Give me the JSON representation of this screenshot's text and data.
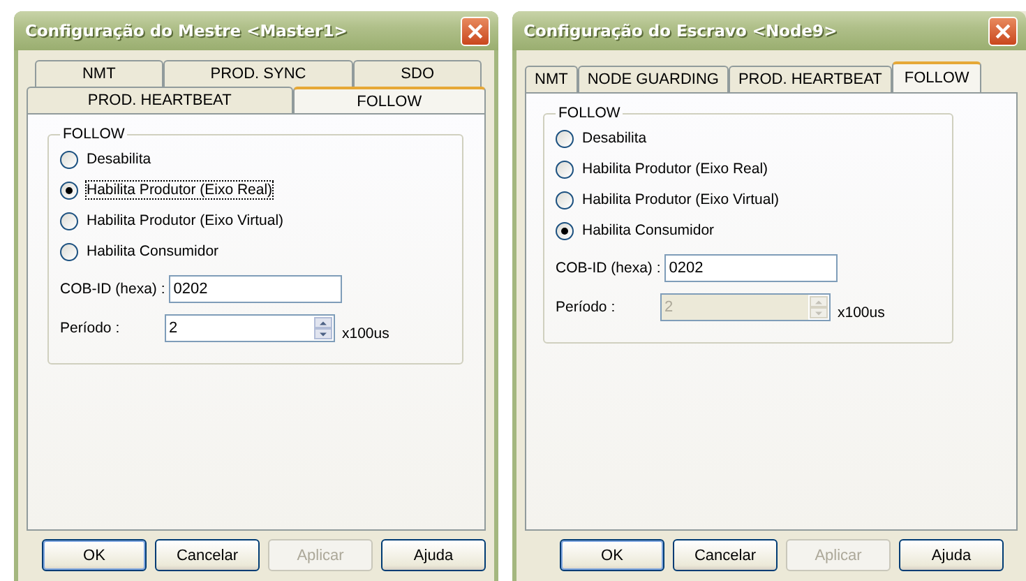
{
  "dialogs": [
    {
      "title": "Configuração do Mestre <Master1>",
      "tab_rows": [
        [
          {
            "label": "NMT",
            "selected": false
          },
          {
            "label": "PROD. SYNC",
            "selected": false
          },
          {
            "label": "SDO",
            "selected": false
          }
        ],
        [
          {
            "label": "PROD. HEARTBEAT",
            "selected": false
          },
          {
            "label": "FOLLOW",
            "selected": true
          }
        ]
      ],
      "group": {
        "title": "FOLLOW",
        "options": [
          {
            "label": "Desabilita",
            "selected": false,
            "focused": false
          },
          {
            "label": "Habilita Produtor (Eixo Real)",
            "selected": true,
            "focused": true
          },
          {
            "label": "Habilita Produtor (Eixo Virtual)",
            "selected": false,
            "focused": false
          },
          {
            "label": "Habilita Consumidor",
            "selected": false,
            "focused": false
          }
        ],
        "cob_id": {
          "label": "COB-ID (hexa) :",
          "value": "0202"
        },
        "periodo": {
          "label": "Período :",
          "value": "2",
          "disabled": false,
          "unit": "x100us"
        }
      },
      "buttons": [
        {
          "label": "OK",
          "disabled": false,
          "default": true
        },
        {
          "label": "Cancelar",
          "disabled": false,
          "default": false
        },
        {
          "label": "Aplicar",
          "disabled": true,
          "default": false
        },
        {
          "label": "Ajuda",
          "disabled": false,
          "default": false
        }
      ]
    },
    {
      "title": "Configuração do Escravo <Node9>",
      "tab_rows": [
        [
          {
            "label": "NMT",
            "selected": false
          },
          {
            "label": "NODE GUARDING",
            "selected": false
          },
          {
            "label": "PROD. HEARTBEAT",
            "selected": false
          },
          {
            "label": "FOLLOW",
            "selected": true
          }
        ]
      ],
      "group": {
        "title": "FOLLOW",
        "options": [
          {
            "label": "Desabilita",
            "selected": false,
            "focused": false
          },
          {
            "label": "Habilita Produtor (Eixo Real)",
            "selected": false,
            "focused": false
          },
          {
            "label": "Habilita Produtor (Eixo Virtual)",
            "selected": false,
            "focused": false
          },
          {
            "label": "Habilita Consumidor",
            "selected": true,
            "focused": false
          }
        ],
        "cob_id": {
          "label": "COB-ID (hexa) :",
          "value": "0202"
        },
        "periodo": {
          "label": "Período :",
          "value": "2",
          "disabled": true,
          "unit": "x100us"
        }
      },
      "buttons": [
        {
          "label": "OK",
          "disabled": false,
          "default": true
        },
        {
          "label": "Cancelar",
          "disabled": false,
          "default": false
        },
        {
          "label": "Aplicar",
          "disabled": true,
          "default": false
        },
        {
          "label": "Ajuda",
          "disabled": false,
          "default": false
        }
      ]
    }
  ]
}
